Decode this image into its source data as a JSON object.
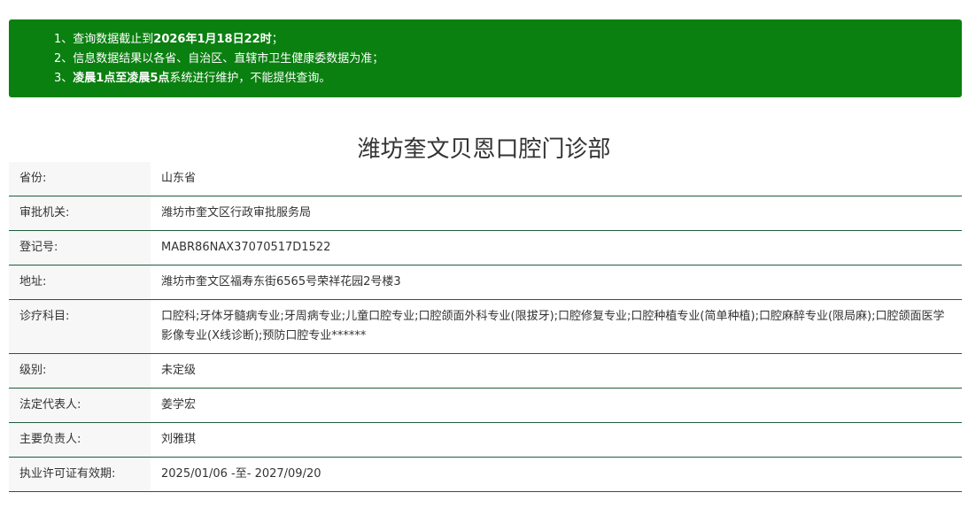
{
  "notice": {
    "line1": {
      "prefix": "1、查询数据截止到",
      "bold": "2026年1月18日22时",
      "suffix": "；"
    },
    "line2": {
      "text": "2、信息数据结果以各省、自治区、直辖市卫生健康委数据为准；"
    },
    "line3": {
      "prefix": "3、",
      "bold": "凌晨1点至凌晨5点",
      "suffix": "系统进行维护，不能提供查询。"
    }
  },
  "title": "潍坊奎文贝恩口腔门诊部",
  "rows": [
    {
      "label": "省份:",
      "value": "山东省"
    },
    {
      "label": "审批机关:",
      "value": "潍坊市奎文区行政审批服务局"
    },
    {
      "label": "登记号:",
      "value": "MABR86NAX37070517D1522"
    },
    {
      "label": "地址:",
      "value": "潍坊市奎文区福寿东街6565号荣祥花园2号楼3"
    },
    {
      "label": "诊疗科目:",
      "value": "口腔科;牙体牙髓病专业;牙周病专业;儿童口腔专业;口腔颌面外科专业(限拔牙);口腔修复专业;口腔种植专业(简单种植);口腔麻醉专业(限局麻);口腔颌面医学影像专业(X线诊断);预防口腔专业******"
    },
    {
      "label": "级别:",
      "value": "未定级"
    },
    {
      "label": "法定代表人:",
      "value": "姜学宏"
    },
    {
      "label": "主要负责人:",
      "value": "刘雅琪"
    },
    {
      "label": "执业许可证有效期:",
      "value": "2025/01/06 -至- 2027/09/20"
    }
  ],
  "colors": {
    "notice_bg": "#0a8010",
    "row_border": "#1e5e3c",
    "label_bg": "#f7f7f7"
  }
}
